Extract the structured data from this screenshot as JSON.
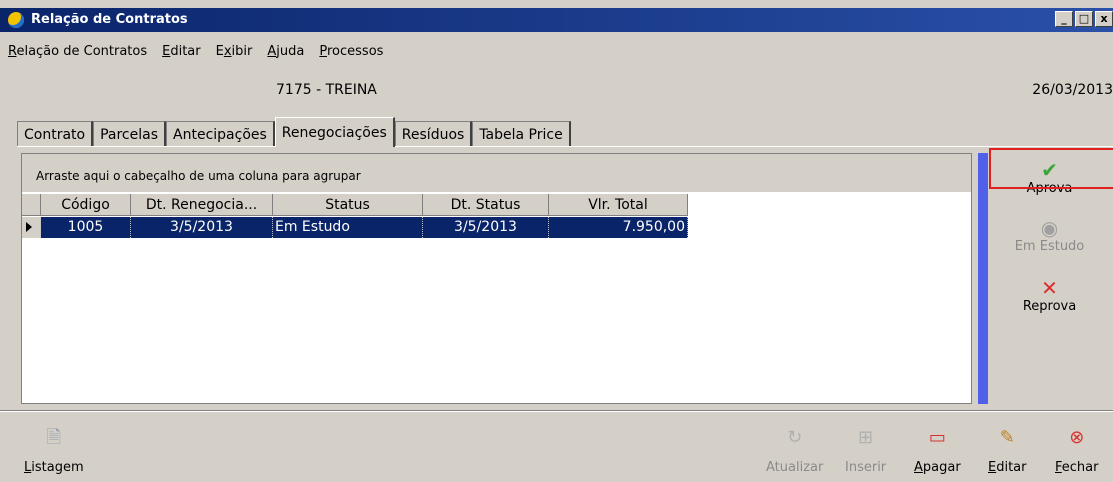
{
  "window": {
    "title": "Relação de Contratos",
    "controls": [
      "_",
      "□",
      "x"
    ]
  },
  "menu": [
    {
      "label": "Relação de Contratos",
      "accel": "R"
    },
    {
      "label": "Editar",
      "accel": "E"
    },
    {
      "label": "Exibir",
      "accel": "x"
    },
    {
      "label": "Ajuda",
      "accel": "A"
    },
    {
      "label": "Processos",
      "accel": "P"
    }
  ],
  "info": {
    "contract": "7175  -  TREINA",
    "date": "26/03/2013"
  },
  "tabs": [
    "Contrato",
    "Parcelas",
    "Antecipações",
    "Renegociações",
    "Resíduos",
    "Tabela Price"
  ],
  "active_tab": "Renegociações",
  "grid": {
    "group_hint": "Arraste aqui o cabeçalho de uma coluna para agrupar",
    "columns": [
      "Código",
      "Dt. Renegocia...",
      "Status",
      "Dt. Status",
      "Vlr. Total"
    ],
    "rows": [
      [
        "1005",
        "3/5/2013",
        "Em Estudo",
        "3/5/2013",
        "7.950,00"
      ]
    ]
  },
  "side_actions": [
    {
      "label": "Aprova",
      "icon": "check-icon",
      "enabled": true,
      "highlighted": true
    },
    {
      "label": "Em Estudo",
      "icon": "eye-icon",
      "enabled": false
    },
    {
      "label": "Reprova",
      "icon": "x-mark-icon",
      "enabled": true
    }
  ],
  "toolbar": {
    "listagem": "Listagem",
    "atualizar": "Atualizar",
    "inserir": "Inserir",
    "apagar": "Apagar",
    "editar": "Editar",
    "fechar": "Fechar"
  },
  "colors": {
    "selection": "#0a246a",
    "highlight_box": "#e02020",
    "check": "#3aa63a",
    "reprova": "#d83030"
  }
}
